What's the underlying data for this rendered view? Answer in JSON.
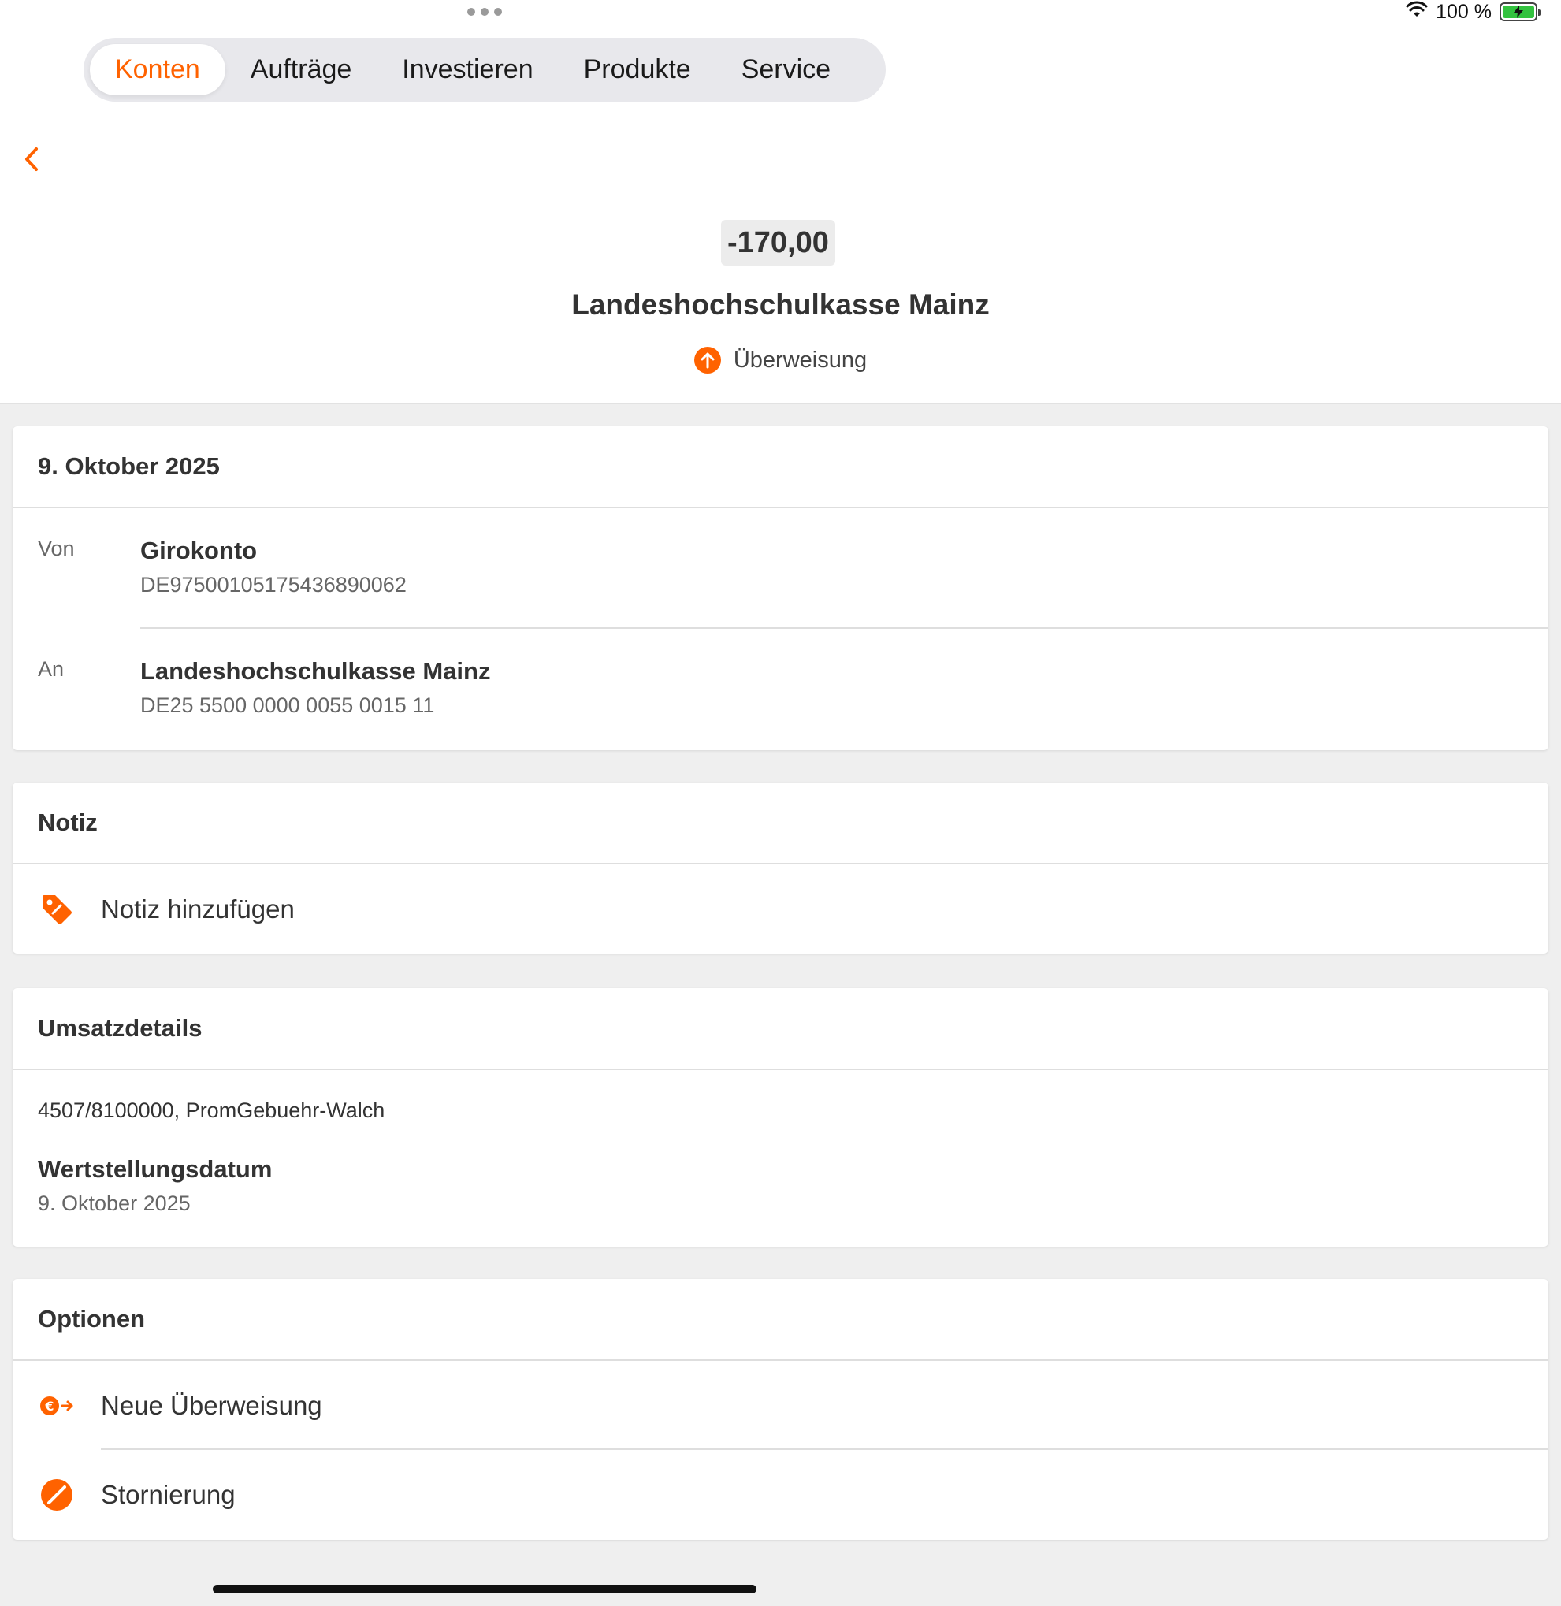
{
  "status_bar": {
    "battery_text": "100 %",
    "battery_level": 1.0
  },
  "tabs": [
    {
      "label": "Konten",
      "active": true
    },
    {
      "label": "Aufträge",
      "active": false
    },
    {
      "label": "Investieren",
      "active": false
    },
    {
      "label": "Produkte",
      "active": false
    },
    {
      "label": "Service",
      "active": false
    }
  ],
  "transaction": {
    "amount": "-170,00",
    "payee": "Landeshochschulkasse Mainz",
    "type": "Überweisung"
  },
  "parties_card": {
    "date": "9. Oktober 2025",
    "from": {
      "label": "Von",
      "name": "Girokonto",
      "iban": "DE97500105175436890062"
    },
    "to": {
      "label": "An",
      "name": "Landeshochschulkasse Mainz",
      "iban": "DE25 5500 0000 0055 0015 11"
    }
  },
  "note_card": {
    "title": "Notiz",
    "add_label": "Notiz hinzufügen"
  },
  "details_card": {
    "title": "Umsatzdetails",
    "reference": "4507/8100000, PromGebuehr-Walch",
    "value_date_label": "Wertstellungsdatum",
    "value_date": "9. Oktober 2025"
  },
  "options_card": {
    "title": "Optionen",
    "items": [
      {
        "label": "Neue Überweisung",
        "icon": "euro-transfer-icon"
      },
      {
        "label": "Stornierung",
        "icon": "cancel-icon"
      }
    ]
  },
  "colors": {
    "accent": "#ff6200",
    "background": "#efefef",
    "card": "#ffffff",
    "text": "#333333",
    "muted": "#666666"
  }
}
